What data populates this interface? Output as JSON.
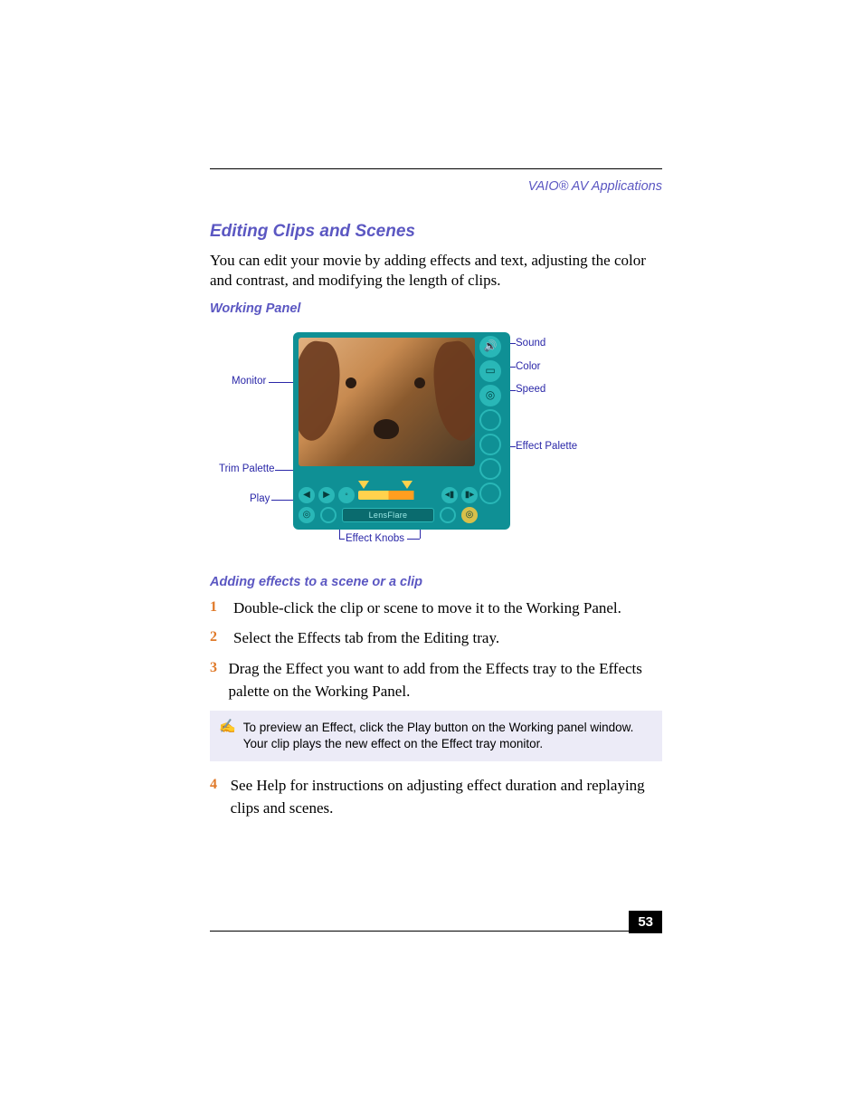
{
  "header": "VAIO® AV Applications",
  "title": "Editing Clips and Scenes",
  "intro": "You can edit your movie by adding effects and text, adjusting the color and contrast, and modifying the length of clips.",
  "figure_caption": "Working Panel",
  "callouts": {
    "monitor": "Monitor",
    "trim": "Trim Palette",
    "play": "Play",
    "knobs": "Effect Knobs",
    "sound": "Sound",
    "color": "Color",
    "speed": "Speed",
    "effect_palette": "Effect Palette"
  },
  "panel": {
    "effect_name": "LensFlare"
  },
  "section2": "Adding effects to a scene or a clip",
  "steps": [
    {
      "n": "1",
      "t": "Double-click the clip or scene to move it to the Working Panel."
    },
    {
      "n": "2",
      "t": "Select the Effects tab from the Editing tray."
    },
    {
      "n": "3",
      "t": "Drag the Effect you want to add from the Effects tray to the Effects palette on the Working Panel."
    },
    {
      "n": "4",
      "t": "See Help for instructions on adjusting effect duration and replaying clips and scenes."
    }
  ],
  "note": "To preview an Effect, click the Play button on the Working panel window. Your clip plays the new effect on the Effect tray monitor.",
  "page_number": "53"
}
